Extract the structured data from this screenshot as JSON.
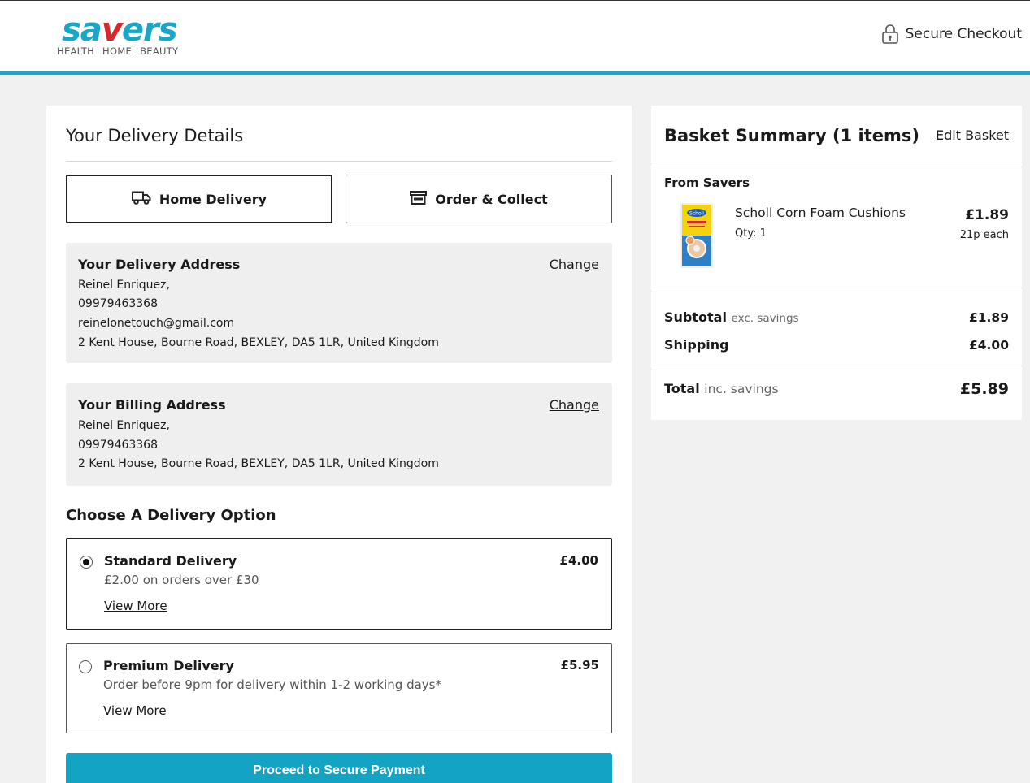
{
  "header": {
    "logo_text_a": "sa",
    "logo_text_v": "v",
    "logo_text_b": "ers",
    "logo_tagline": "HEALTH HOME BEAUTY",
    "secure_label": "Secure Checkout"
  },
  "delivery": {
    "title": "Your Delivery Details",
    "tabs": [
      {
        "label": "Home Delivery",
        "icon": "truck-icon",
        "selected": true
      },
      {
        "label": "Order & Collect",
        "icon": "store-icon",
        "selected": false
      }
    ],
    "delivery_address": {
      "title": "Your Delivery Address",
      "change_label": "Change",
      "name": "Reinel Enriquez,",
      "phone": "09979463368",
      "email": "reinelonetouch@gmail.com",
      "address": "2 Kent House, Bourne Road, BEXLEY, DA5 1LR, United Kingdom"
    },
    "billing_address": {
      "title": "Your Billing Address",
      "change_label": "Change",
      "name": "Reinel Enriquez,",
      "phone": "09979463368",
      "address": "2 Kent House, Bourne Road, BEXLEY, DA5 1LR, United Kingdom"
    },
    "options_heading": "Choose A Delivery Option",
    "options": [
      {
        "name": "Standard Delivery",
        "price": "£4.00",
        "description": "£2.00 on orders over £30",
        "more": "View More",
        "selected": true
      },
      {
        "name": "Premium Delivery",
        "price": "£5.95",
        "description": "Order before 9pm for delivery within 1-2 working days*",
        "more": "View More",
        "selected": false
      }
    ],
    "pay_button": "Proceed to Secure Payment"
  },
  "basket": {
    "title": "Basket Summary (1 items)",
    "edit_label": "Edit Basket",
    "from_label": "From Savers",
    "item": {
      "name": "Scholl Corn Foam Cushions",
      "qty": "Qty: 1",
      "price": "£1.89",
      "unit_price": "21p each",
      "image_brand_text": "Scholl"
    },
    "subtotal_label": "Subtotal",
    "subtotal_note": "exc. savings",
    "subtotal_value": "£1.89",
    "shipping_label": "Shipping",
    "shipping_value": "£4.00",
    "total_label": "Total",
    "total_note": "inc. savings",
    "total_value": "£5.89"
  },
  "colors": {
    "accent": "#13a4c4",
    "brand_red": "#d9262b"
  }
}
